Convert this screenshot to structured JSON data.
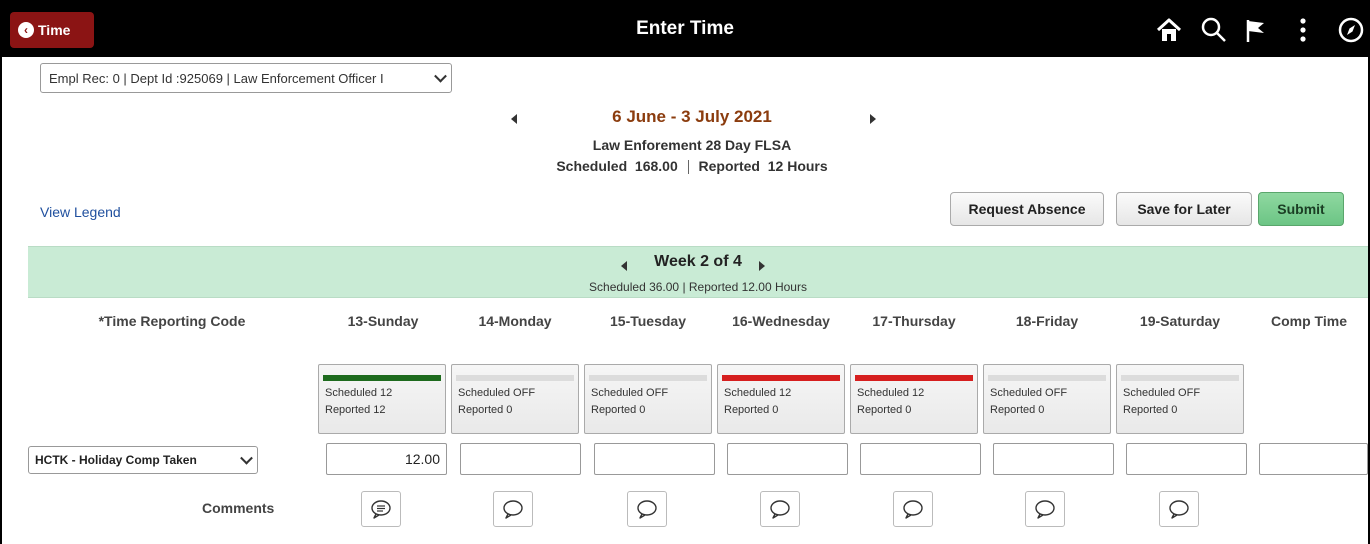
{
  "header": {
    "back_label": "Time",
    "title": "Enter Time",
    "icons": [
      "home-icon",
      "search-icon",
      "flag-icon",
      "more-actions-icon",
      "navbar-compass-icon"
    ]
  },
  "employment_select": {
    "value": "Empl Rec: 0 | Dept Id :925069 | Law Enforcement Officer I"
  },
  "period": {
    "range": "6 June - 3 July 2021",
    "schedule_name": "Law Enforement 28 Day FLSA",
    "scheduled_label": "Scheduled",
    "scheduled_value": "168.00",
    "reported_label": "Reported",
    "reported_value": "12 Hours"
  },
  "legend_link": "View Legend",
  "actions": {
    "request_absence": "Request Absence",
    "save_for_later": "Save for Later",
    "submit": "Submit"
  },
  "week": {
    "title": "Week 2 of 4",
    "summary": "Scheduled 36.00 | Reported 12.00 Hours"
  },
  "columns": {
    "trc": "*Time Reporting Code",
    "days": [
      "13-Sunday",
      "14-Monday",
      "15-Tuesday",
      "16-Wednesday",
      "17-Thursday",
      "18-Friday",
      "19-Saturday"
    ],
    "comp_time": "Comp Time"
  },
  "day_cards": [
    {
      "scheduled": "Scheduled 12",
      "reported": "Reported 12",
      "status_color": "#1e6b1e"
    },
    {
      "scheduled": "Scheduled OFF",
      "reported": "Reported 0",
      "status_color": "#dcdcdc"
    },
    {
      "scheduled": "Scheduled OFF",
      "reported": "Reported 0",
      "status_color": "#dcdcdc"
    },
    {
      "scheduled": "Scheduled 12",
      "reported": "Reported 0",
      "status_color": "#d61f1f"
    },
    {
      "scheduled": "Scheduled 12",
      "reported": "Reported 0",
      "status_color": "#d61f1f"
    },
    {
      "scheduled": "Scheduled OFF",
      "reported": "Reported 0",
      "status_color": "#dcdcdc"
    },
    {
      "scheduled": "Scheduled OFF",
      "reported": "Reported 0",
      "status_color": "#dcdcdc"
    }
  ],
  "time_row": {
    "trc_value": "HCTK - Holiday Comp Taken",
    "hours": [
      "12.00",
      "",
      "",
      "",
      "",
      "",
      "",
      ""
    ]
  },
  "comments": {
    "label": "Comments",
    "states": [
      "has-comment",
      "empty",
      "empty",
      "empty",
      "empty",
      "empty",
      "empty"
    ]
  },
  "colors": {
    "header_bg": "#000000",
    "back_button": "#8b1414",
    "period_title": "#8b3c0e",
    "week_band": "#c9ebd5",
    "submit": "#6cc585",
    "link": "#1f4f9e"
  }
}
